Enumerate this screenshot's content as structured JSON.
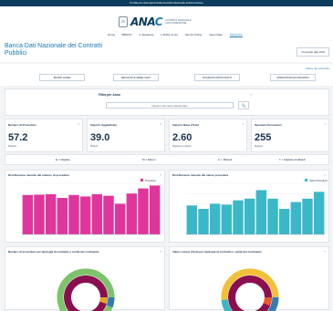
{
  "topbar": {
    "text": "Portale dei dati aperti della Autorità Nazionale Anticorruzione"
  },
  "logo": {
    "emblem": "⚖",
    "word_a": "ANA",
    "word_c": "C",
    "subtitle": "AUTORITÀ NAZIONALE ANTICORRUZIONE"
  },
  "nav": {
    "items": [
      "Home",
      "BDNCP",
      "In Evidenza",
      "L'ANAC di più",
      "Servizi Online",
      "Open Data",
      "Statistiche"
    ]
  },
  "page": {
    "title": "Banca Dati Nazionale dei Contratti Pubblici",
    "header_button": "Cruscotto dati OAS"
  },
  "tabs": {
    "small_link": "Indice del cruscotto",
    "items": [
      "BANDI GARE",
      "REGIONI E AREE GEO",
      "STAZIONI APPALTANTI",
      "OPERATORI ECONOMICI"
    ]
  },
  "filter": {
    "label": "Filtra per Anno",
    "help": "?",
    "placeholder": "Nessun elemento selezionato",
    "button": "🔍"
  },
  "kpis": [
    {
      "label": "Numero di Procedure",
      "value": "57.2",
      "unit": "Migliaia"
    },
    {
      "label": "Importo Aggiudicato",
      "value": "39.0",
      "unit": "Miliardi"
    },
    {
      "label": "Importo Base d'Asta",
      "value": "2.60",
      "unit": "Migliaia di miliardi"
    },
    {
      "label": "Operatori Economici",
      "value": "255",
      "unit": "Migliaia"
    }
  ],
  "legend_row": [
    "E = Migliaia",
    "M = Milioni",
    "G = Miliardi",
    "T = Migliaia di Miliardi"
  ],
  "help_icon": "?",
  "chart_left": {
    "title": "Distribuzione mensile del numero di procedure",
    "color": "#e0359b"
  },
  "chart_right": {
    "title": "Distribuzione mensile del valore procedure",
    "color": "#3bb8c8"
  },
  "donut_left": {
    "title": "Numero di procedure per tipologia di contratto e scelta del contraente"
  },
  "donut_right": {
    "title": "Valore a base d'asta per tipologia di contratto e scelta del contraente"
  },
  "chart_data": [
    {
      "type": "bar",
      "title": "Distribuzione mensile del numero di procedure",
      "legend": [
        "Procedure"
      ],
      "categories": [
        "",
        "",
        "",
        "",
        "",
        "",
        "",
        "",
        "",
        "",
        "",
        ""
      ],
      "ylabel": "",
      "xlabel": "",
      "values": [
        2.7,
        2.72,
        2.75,
        2.5,
        2.7,
        2.6,
        2.75,
        2.65,
        2.1,
        2.8,
        3.15,
        3.35
      ],
      "ylim": [
        0,
        3.5
      ],
      "color": "#e0359b"
    },
    {
      "type": "bar",
      "title": "Distribuzione mensile del valore procedure",
      "legend": [
        "Valore Procedure"
      ],
      "categories": [
        "",
        "",
        "",
        "",
        "",
        "",
        "",
        "",
        "",
        "",
        "",
        ""
      ],
      "ylabel": "",
      "xlabel": "",
      "values": [
        1.7,
        1.5,
        1.8,
        1.75,
        2.0,
        2.1,
        2.6,
        2.1,
        1.5,
        1.9,
        2.1,
        2.5
      ],
      "ylim": [
        0,
        3.0
      ],
      "color": "#3bb8c8"
    }
  ]
}
